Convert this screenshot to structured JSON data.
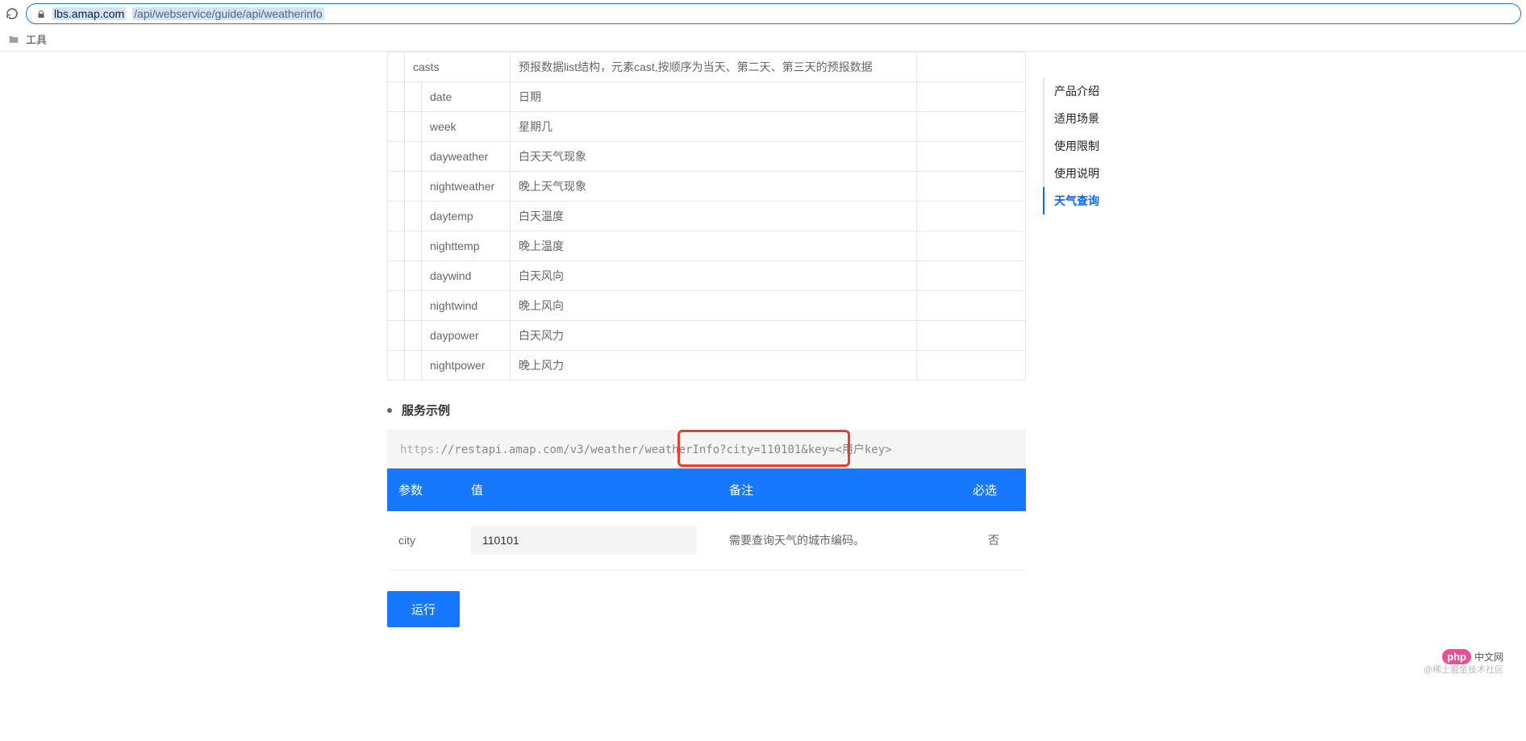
{
  "browser": {
    "url_host": "lbs.amap.com",
    "url_path": "/api/webservice/guide/api/weatherinfo",
    "bookmark_folder": "工具"
  },
  "api_rows": [
    {
      "indent": 1,
      "field": "casts",
      "desc": "预报数据list结构，元素cast,按顺序为当天、第二天、第三天的预报数据"
    },
    {
      "indent": 2,
      "field": "date",
      "desc": "日期"
    },
    {
      "indent": 2,
      "field": "week",
      "desc": "星期几"
    },
    {
      "indent": 2,
      "field": "dayweather",
      "desc": "白天天气现象"
    },
    {
      "indent": 2,
      "field": "nightweather",
      "desc": "晚上天气现象"
    },
    {
      "indent": 2,
      "field": "daytemp",
      "desc": "白天温度"
    },
    {
      "indent": 2,
      "field": "nighttemp",
      "desc": "晚上温度"
    },
    {
      "indent": 2,
      "field": "daywind",
      "desc": "白天风向"
    },
    {
      "indent": 2,
      "field": "nightwind",
      "desc": "晚上风向"
    },
    {
      "indent": 2,
      "field": "daypower",
      "desc": "白天风力"
    },
    {
      "indent": 2,
      "field": "nightpower",
      "desc": "晚上风力"
    }
  ],
  "sidemenu": [
    {
      "label": "产品介绍",
      "active": false
    },
    {
      "label": "适用场景",
      "active": false
    },
    {
      "label": "使用限制",
      "active": false
    },
    {
      "label": "使用说明",
      "active": false
    },
    {
      "label": "天气查询",
      "active": true
    }
  ],
  "example": {
    "title": "服务示例",
    "url_scheme": "https:",
    "url_rest": "//restapi.amap.com/v3/weather/weatherInfo?city=110101&key=<用户key>"
  },
  "param_table": {
    "headers": {
      "param": "参数",
      "value": "值",
      "remark": "备注",
      "required": "必选"
    },
    "rows": [
      {
        "param": "city",
        "value": "110101",
        "remark": "需要查询天气的城市编码。",
        "required": "否"
      }
    ]
  },
  "run_button": "运行",
  "watermark": {
    "php_badge": "php",
    "php_label": "中文网",
    "juejin": "@稀土掘金技术社区"
  }
}
